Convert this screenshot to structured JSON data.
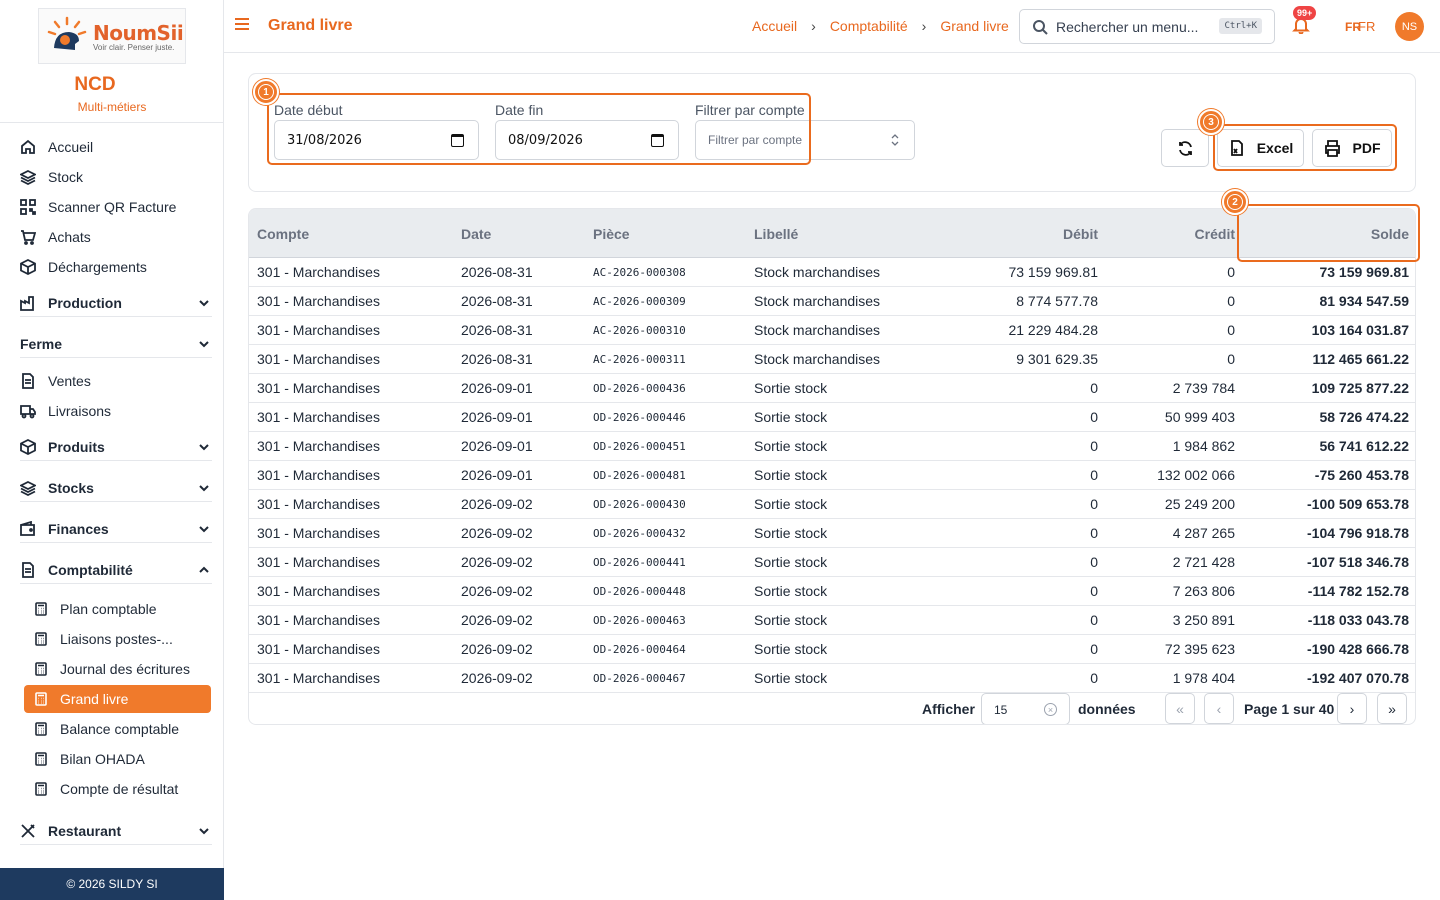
{
  "brand": {
    "logo_title": "NoumSii",
    "logo_tagline": "Voir clair. Penser juste.",
    "org_name": "NCD",
    "org_sub": "Multi-métiers"
  },
  "sidebar": {
    "top_items": [
      {
        "label": "Accueil",
        "icon": "home-icon"
      },
      {
        "label": "Stock",
        "icon": "layers-icon"
      },
      {
        "label": "Scanner QR Facture",
        "icon": "qr-icon"
      },
      {
        "label": "Achats",
        "icon": "cart-icon"
      },
      {
        "label": "Déchargements",
        "icon": "box-icon"
      }
    ],
    "groups": {
      "production": "Production",
      "ferme": "Ferme",
      "produits": "Produits",
      "stocks": "Stocks",
      "finances": "Finances",
      "comptabilite": "Comptabilité",
      "restaurant": "Restaurant"
    },
    "ferme_items": [
      {
        "label": "Ventes"
      },
      {
        "label": "Livraisons"
      }
    ],
    "compta_items": [
      {
        "label": "Plan comptable"
      },
      {
        "label": "Liaisons postes-..."
      },
      {
        "label": "Journal des écritures"
      },
      {
        "label": "Grand livre"
      },
      {
        "label": "Balance comptable"
      },
      {
        "label": "Bilan OHADA"
      },
      {
        "label": "Compte de résultat"
      }
    ],
    "footer": "© 2026 SILDY SI"
  },
  "header": {
    "page_title": "Grand livre",
    "breadcrumbs": [
      "Accueil",
      "Comptabilité",
      "Grand livre"
    ],
    "search_placeholder": "Rechercher un menu...",
    "search_shortcut": "Ctrl+K",
    "notif_badge": "99+",
    "lang_flag": "FR",
    "lang": "FR",
    "avatar": "NS"
  },
  "filters": {
    "date_start_label": "Date début",
    "date_start_value": "31/08/2026",
    "date_end_label": "Date fin",
    "date_end_value": "08/09/2026",
    "account_label": "Filtrer par compte",
    "account_placeholder": "Filtrer par compte",
    "excel_label": "Excel",
    "pdf_label": "PDF"
  },
  "markers": [
    "1",
    "2",
    "3"
  ],
  "table": {
    "columns": [
      "Compte",
      "Date",
      "Pièce",
      "Libellé",
      "Débit",
      "Crédit",
      "Solde"
    ],
    "rows": [
      [
        "301 - Marchandises",
        "2026-08-31",
        "AC-2026-000308",
        "Stock marchandises",
        "73 159 969.81",
        "0",
        "73 159 969.81"
      ],
      [
        "301 - Marchandises",
        "2026-08-31",
        "AC-2026-000309",
        "Stock marchandises",
        "8 774 577.78",
        "0",
        "81 934 547.59"
      ],
      [
        "301 - Marchandises",
        "2026-08-31",
        "AC-2026-000310",
        "Stock marchandises",
        "21 229 484.28",
        "0",
        "103 164 031.87"
      ],
      [
        "301 - Marchandises",
        "2026-08-31",
        "AC-2026-000311",
        "Stock marchandises",
        "9 301 629.35",
        "0",
        "112 465 661.22"
      ],
      [
        "301 - Marchandises",
        "2026-09-01",
        "OD-2026-000436",
        "Sortie stock",
        "0",
        "2 739 784",
        "109 725 877.22"
      ],
      [
        "301 - Marchandises",
        "2026-09-01",
        "OD-2026-000446",
        "Sortie stock",
        "0",
        "50 999 403",
        "58 726 474.22"
      ],
      [
        "301 - Marchandises",
        "2026-09-01",
        "OD-2026-000451",
        "Sortie stock",
        "0",
        "1 984 862",
        "56 741 612.22"
      ],
      [
        "301 - Marchandises",
        "2026-09-01",
        "OD-2026-000481",
        "Sortie stock",
        "0",
        "132 002 066",
        "-75 260 453.78"
      ],
      [
        "301 - Marchandises",
        "2026-09-02",
        "OD-2026-000430",
        "Sortie stock",
        "0",
        "25 249 200",
        "-100 509 653.78"
      ],
      [
        "301 - Marchandises",
        "2026-09-02",
        "OD-2026-000432",
        "Sortie stock",
        "0",
        "4 287 265",
        "-104 796 918.78"
      ],
      [
        "301 - Marchandises",
        "2026-09-02",
        "OD-2026-000441",
        "Sortie stock",
        "0",
        "2 721 428",
        "-107 518 346.78"
      ],
      [
        "301 - Marchandises",
        "2026-09-02",
        "OD-2026-000448",
        "Sortie stock",
        "0",
        "7 263 806",
        "-114 782 152.78"
      ],
      [
        "301 - Marchandises",
        "2026-09-02",
        "OD-2026-000463",
        "Sortie stock",
        "0",
        "3 250 891",
        "-118 033 043.78"
      ],
      [
        "301 - Marchandises",
        "2026-09-02",
        "OD-2026-000464",
        "Sortie stock",
        "0",
        "72 395 623",
        "-190 428 666.78"
      ],
      [
        "301 - Marchandises",
        "2026-09-02",
        "OD-2026-000467",
        "Sortie stock",
        "0",
        "1 978 404",
        "-192 407 070.78"
      ]
    ]
  },
  "pagination": {
    "show_label": "Afficher",
    "page_size": "15",
    "data_label": "données",
    "page_info": "Page 1 sur 40",
    "first": "«",
    "prev": "‹",
    "next": "›",
    "last": "»"
  },
  "colors": {
    "accent": "#f07a2b",
    "footer": "#1e3a5f",
    "badge": "#ef4444"
  }
}
